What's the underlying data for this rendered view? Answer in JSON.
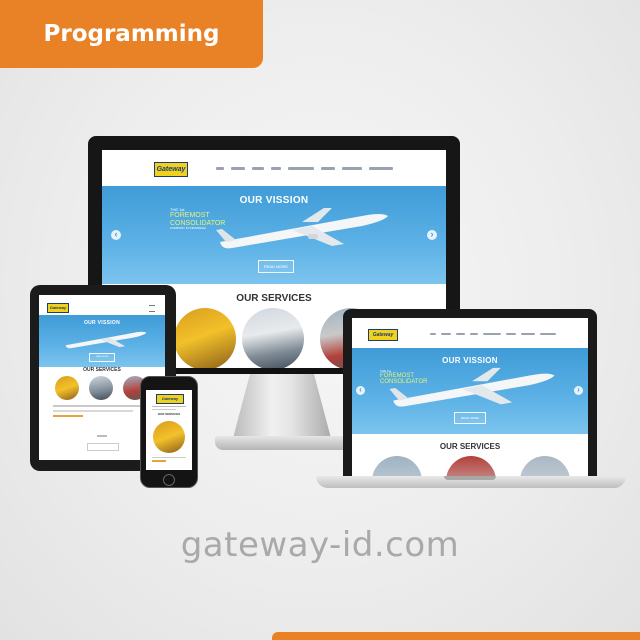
{
  "badge": {
    "label": "Programming"
  },
  "footer": {
    "url": "gateway-id.com"
  },
  "site": {
    "logo_text": "Gateway",
    "hero_title": "OUR VISSION",
    "tagline_small": "THE 1st",
    "tagline_line1": "FOREMOST",
    "tagline_line2": "CONSOLIDATOR",
    "tagline_sub": "COMPANY IN INDONESIA",
    "read_more": "READ MORE",
    "services_title": "OUR SERVICES",
    "prev_arrow": "‹",
    "next_arrow": "›"
  },
  "colors": {
    "accent": "#e98227",
    "hero_blue": "#4aa6de",
    "logo_yellow": "#f1d21b",
    "logo_blue": "#1c3b7a"
  }
}
